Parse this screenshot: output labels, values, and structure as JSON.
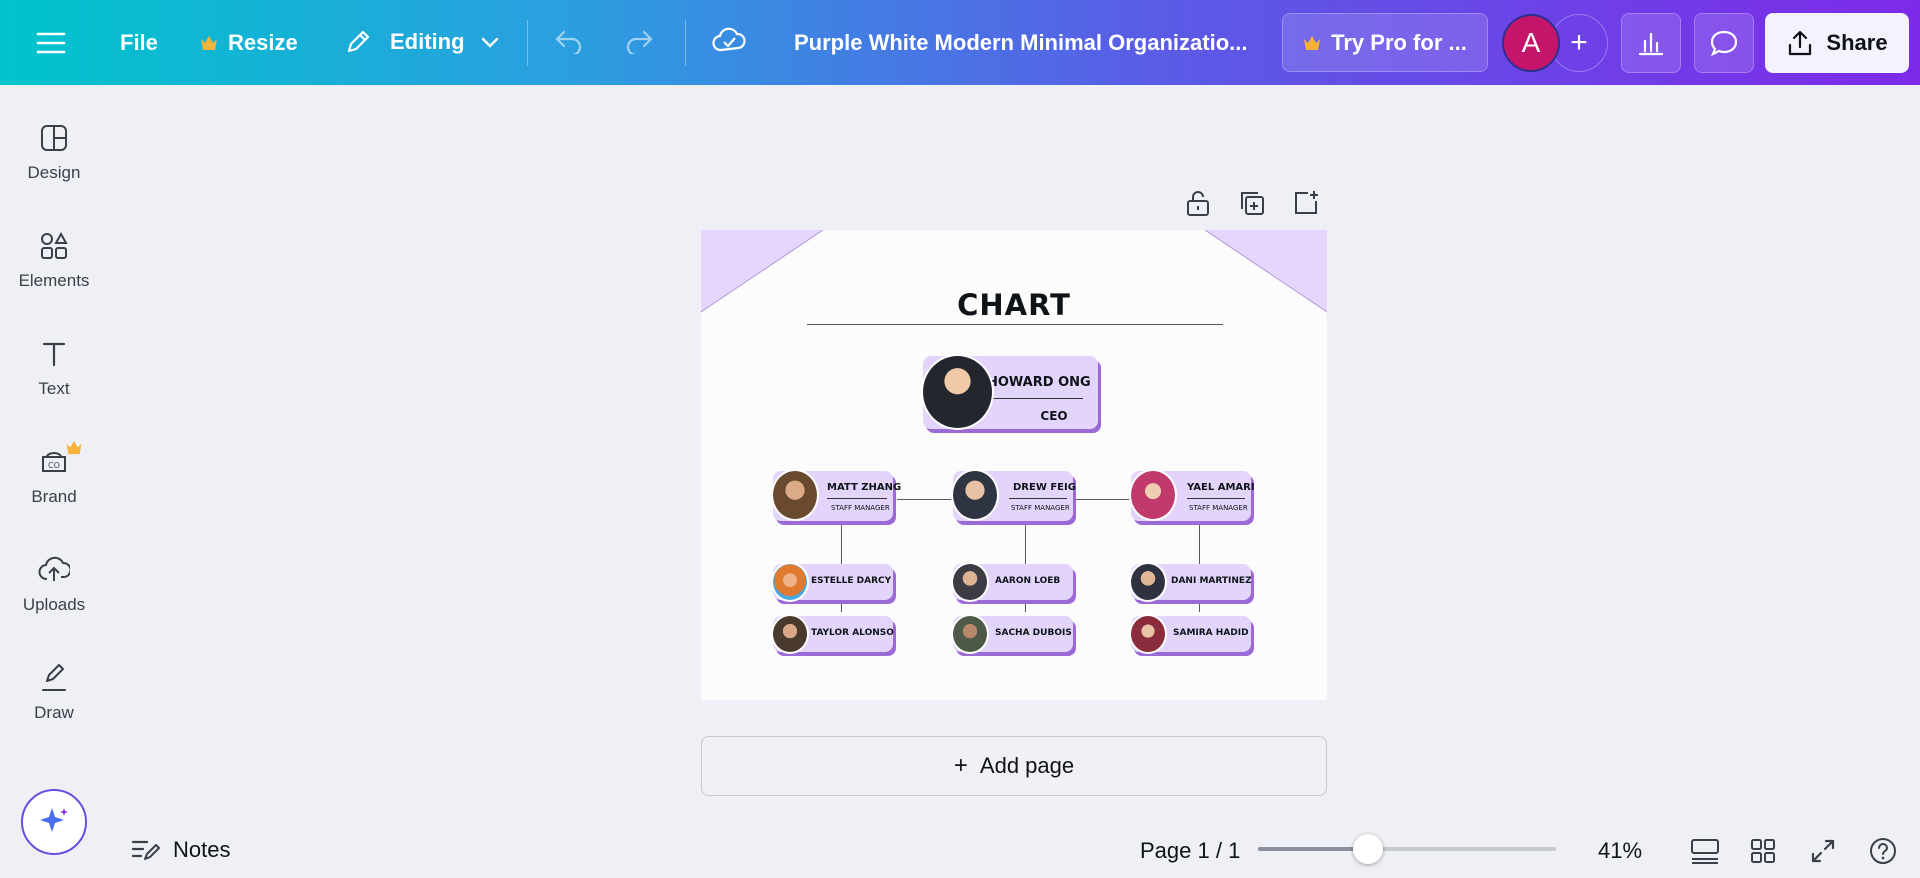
{
  "topbar": {
    "file_label": "File",
    "resize_label": "Resize",
    "editing_label": "Editing",
    "doc_title": "Purple White Modern Minimal Organizatio...",
    "pro_label": "Try Pro for ...",
    "avatar_initial": "A",
    "share_label": "Share"
  },
  "sidebar": {
    "items": [
      {
        "label": "Design",
        "icon": "design-icon"
      },
      {
        "label": "Elements",
        "icon": "elements-icon"
      },
      {
        "label": "Text",
        "icon": "text-icon"
      },
      {
        "label": "Brand",
        "icon": "brand-icon"
      },
      {
        "label": "Uploads",
        "icon": "uploads-icon"
      },
      {
        "label": "Draw",
        "icon": "draw-icon"
      }
    ]
  },
  "design": {
    "title": "CHART",
    "ceo": {
      "name": "HOWARD ONG",
      "role": "CEO"
    },
    "managers": [
      {
        "name": "MATT ZHANG",
        "role": "STAFF MANAGER"
      },
      {
        "name": "DREW FEIG",
        "role": "STAFF MANAGER"
      },
      {
        "name": "YAEL AMARI",
        "role": "STAFF MANAGER"
      }
    ],
    "staff": [
      [
        "ESTELLE DARCY",
        "TAYLOR ALONSO"
      ],
      [
        "AARON LOEB",
        "SACHA DUBOIS"
      ],
      [
        "DANI MARTINEZ",
        "SAMIRA HADID"
      ]
    ]
  },
  "canvas": {
    "add_page_label": "Add page"
  },
  "bottombar": {
    "notes_label": "Notes",
    "page_indicator": "Page 1 / 1",
    "zoom_fraction": 0.37,
    "zoom_label": "41%"
  },
  "colors": {
    "card_fill": "#e3d4fc",
    "card_shadow": "#9b6ad6",
    "accent": "#7d2ae8"
  }
}
